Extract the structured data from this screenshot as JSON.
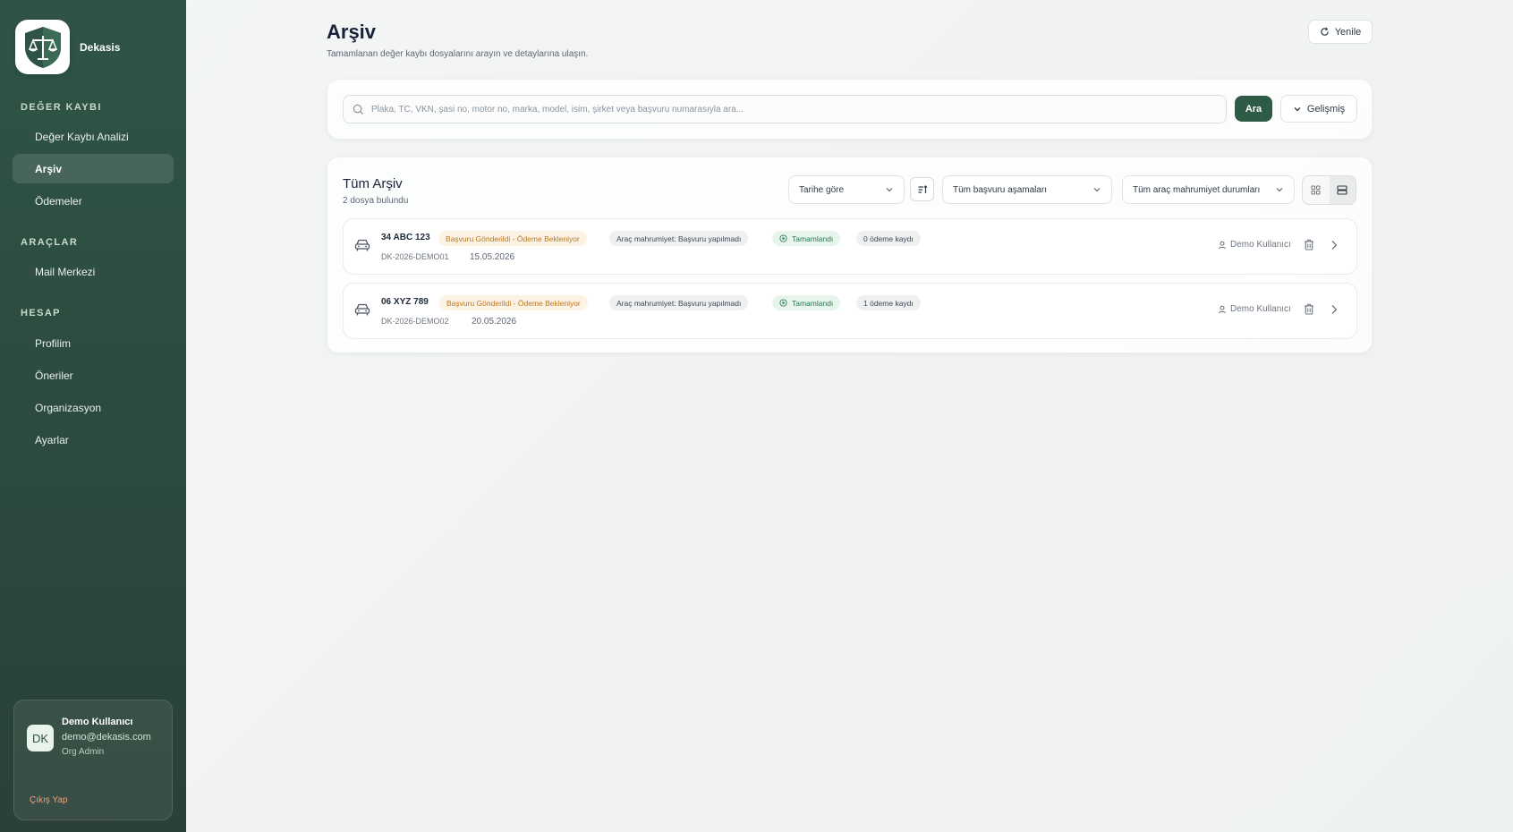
{
  "brand": {
    "name": "Dekasis"
  },
  "sidebar": {
    "sections": [
      {
        "title": "DEĞER KAYBI",
        "items": [
          {
            "label": "Değer Kaybı Analizi",
            "active": false
          },
          {
            "label": "Arşiv",
            "active": true
          },
          {
            "label": "Ödemeler",
            "active": false
          }
        ]
      },
      {
        "title": "ARAÇLAR",
        "items": [
          {
            "label": "Mail Merkezi",
            "active": false
          }
        ]
      },
      {
        "title": "HESAP",
        "items": [
          {
            "label": "Profilim",
            "active": false
          },
          {
            "label": "Öneriler",
            "active": false
          },
          {
            "label": "Organizasyon",
            "active": false
          },
          {
            "label": "Ayarlar",
            "active": false
          }
        ]
      }
    ],
    "user": {
      "initials": "DK",
      "name": "Demo Kullanıcı",
      "email": "demo@dekasis.com",
      "role": "Org Admin",
      "logout_label": "Çıkış Yap"
    }
  },
  "header": {
    "title": "Arşiv",
    "subtitle": "Tamamlanan değer kaybı dosyalarını arayın ve detaylarına ulaşın.",
    "refresh_label": "Yenile"
  },
  "search": {
    "placeholder": "Plaka, TC, VKN, şasi no, motor no, marka, model, isim, şirket veya başvuru numarasıyla ara...",
    "value": "",
    "button_label": "Ara",
    "advanced_label": "Gelişmiş"
  },
  "archive": {
    "title": "Tüm Arşiv",
    "count_text": "2 dosya bulundu",
    "filters": {
      "sort": "Tarihe göre",
      "stage": "Tüm başvuru aşamaları",
      "privacy": "Tüm araç mahrumiyet durumları"
    },
    "view_mode": "list",
    "rows": [
      {
        "plate": "34 ABC 123",
        "file_no": "DK-2026-DEMO01",
        "date": "15.05.2026",
        "status": "Başvuru Gönderildi - Ödeme Bekleniyor",
        "privacy": "Araç mahrumiyet: Başvuru yapılmadı",
        "completion": "Tamamlandı",
        "payments": "0 ödeme kaydı",
        "user": "Demo Kullanıcı"
      },
      {
        "plate": "06 XYZ 789",
        "file_no": "DK-2026-DEMO02",
        "date": "20.05.2026",
        "status": "Başvuru Gönderildi - Ödeme Bekleniyor",
        "privacy": "Araç mahrumiyet: Başvuru yapılmadı",
        "completion": "Tamamlandı",
        "payments": "1 ödeme kaydı",
        "user": "Demo Kullanıcı"
      }
    ]
  },
  "colors": {
    "sidebar_bg": "#2f5446",
    "accent": "#2e5b46",
    "status_orange": "#b7781f",
    "status_green": "#2f7a52"
  }
}
